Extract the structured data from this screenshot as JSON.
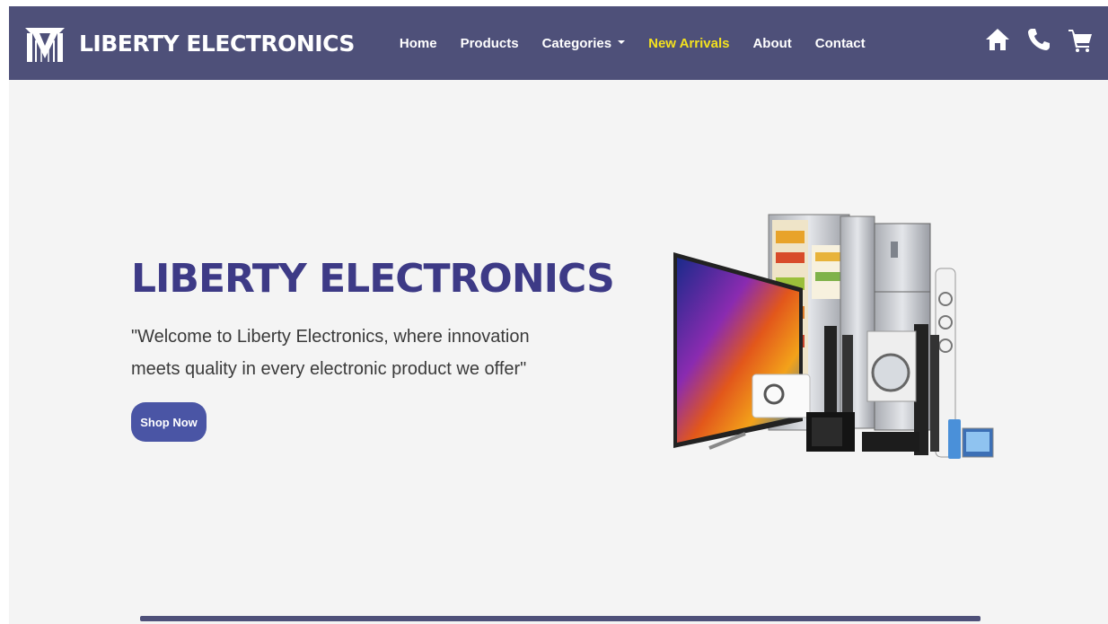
{
  "brand": {
    "name": "LIBERTY ELECTRONICS",
    "logo_icon": "liberty-logo-icon"
  },
  "nav": {
    "links": [
      {
        "label": "Home"
      },
      {
        "label": "Products"
      },
      {
        "label": "Categories",
        "has_dropdown": true
      },
      {
        "label": "New Arrivals",
        "active": true
      },
      {
        "label": "About"
      },
      {
        "label": "Contact"
      }
    ],
    "icons": [
      "home-icon",
      "phone-icon",
      "cart-icon"
    ]
  },
  "hero": {
    "title": "LIBERTY ELECTRONICS",
    "tagline": "\"Welcome to Liberty Electronics, where innovation meets quality in every electronic product we offer\"",
    "button_label": "Shop Now"
  },
  "colors": {
    "navbar": "#4e5079",
    "active_link": "#f4e11e",
    "title": "#3d3a86",
    "button": "#4a55a5",
    "background": "#f4f4f4"
  }
}
